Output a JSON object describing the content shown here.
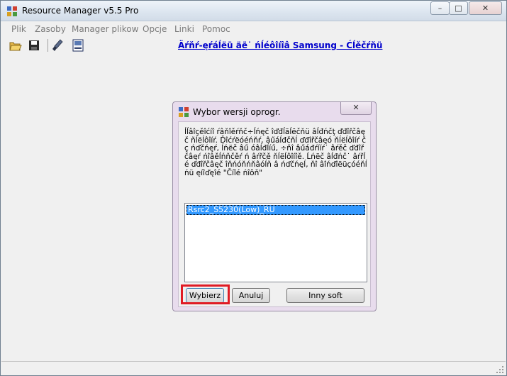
{
  "window": {
    "title": "Resource Manager v5.5 Pro",
    "controls": {
      "minimize": "–",
      "maximize": "□",
      "close": "✕"
    }
  },
  "menu": [
    "Plik",
    "Zasoby",
    "Manager plikow",
    "Opcje",
    "Linki",
    "Pomoc"
  ],
  "toolbar": {
    "icons": [
      "open-folder-icon",
      "save-icon",
      "brush-icon",
      "document-icon"
    ],
    "link_text": "Äŕňŕ-ęŕáĺëü äë˙ ńĺéôîíîâ Samsung - Ćĺěčŕňü"
  },
  "dialog": {
    "title": "Wybor wersji oprogr.",
    "close": "✕",
    "message": "Íĺâîçěîćíî ŕâňîěŕňč÷ĺńęč îďđĺäĺëčňü âĺđńčţ ďđîřčâęč ňĺëĺôîíŕ. Ďîćŕëóéńňŕ, âűáĺđčňĺ ďđîřčâęó ňĺëĺôîíŕ čç ńďčńęŕ, ĺńëč âű óâĺđĺíű, ÷ňî âűáđŕííŕ˙ âŕěč ďđîřčâęŕ ńîâěĺńňčěŕ ń âŕřčě ňĺëĺôîíîě. Ĺńëč âĺđńč˙ âŕřĺé ďđîřčâęč îňńóňńňâóĺň â ńďčńęĺ, ňî âîńďîëüçóéňĺńü ęíîďęîé \"Číîé ńîôň\"",
    "list_items": [
      "Rsrc2_S5230(Low)_RU"
    ],
    "buttons": {
      "select": "Wybierz",
      "cancel": "Anuluj",
      "other": "Inny soft"
    }
  },
  "colors": {
    "highlight": "#e01b24",
    "link": "#0000cc",
    "selection": "#3399ff"
  }
}
